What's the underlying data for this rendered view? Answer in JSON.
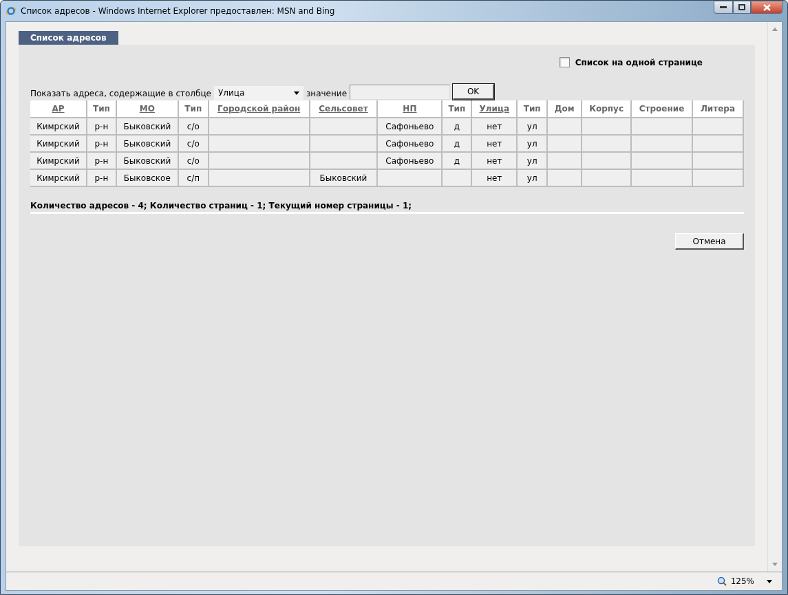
{
  "window": {
    "title": "Список адресов - Windows Internet Explorer предоставлен: MSN and Bing"
  },
  "tab": {
    "label": "Список адресов"
  },
  "single_page": {
    "label": "Список на одной странице",
    "checked": false
  },
  "filter": {
    "label": "Показать адреса, содержащие в столбце",
    "column": "Улица",
    "value_label": "значение",
    "ok": "OK"
  },
  "table": {
    "columns": [
      {
        "label": "АР",
        "sortable": true
      },
      {
        "label": "Тип",
        "sortable": false
      },
      {
        "label": "МО",
        "sortable": true
      },
      {
        "label": "Тип",
        "sortable": false
      },
      {
        "label": "Городской район",
        "sortable": true
      },
      {
        "label": "Сельсовет",
        "sortable": true
      },
      {
        "label": "НП",
        "sortable": true
      },
      {
        "label": "Тип",
        "sortable": false
      },
      {
        "label": "Улица",
        "sortable": true
      },
      {
        "label": "Тип",
        "sortable": false
      },
      {
        "label": "Дом",
        "sortable": false
      },
      {
        "label": "Корпус",
        "sortable": false
      },
      {
        "label": "Строение",
        "sortable": false
      },
      {
        "label": "Литера",
        "sortable": false
      }
    ],
    "rows": [
      [
        "Кимрский",
        "р-н",
        "Быковский",
        "с/о",
        "",
        "",
        "Сафоньево",
        "д",
        "нет",
        "ул",
        "",
        "",
        "",
        ""
      ],
      [
        "Кимрский",
        "р-н",
        "Быковский",
        "с/о",
        "",
        "",
        "Сафоньево",
        "д",
        "нет",
        "ул",
        "",
        "",
        "",
        ""
      ],
      [
        "Кимрский",
        "р-н",
        "Быковский",
        "с/о",
        "",
        "",
        "Сафоньево",
        "д",
        "нет",
        "ул",
        "",
        "",
        "",
        ""
      ],
      [
        "Кимрский",
        "р-н",
        "Быковское",
        "с/п",
        "",
        "Быковский",
        "",
        "",
        "нет",
        "ул",
        "",
        "",
        "",
        ""
      ]
    ]
  },
  "summary": "Количество адресов - 4; Количество страниц - 1; Текущий номер страницы - 1;",
  "cancel": "Отмена",
  "status_bar": {
    "zoom": "125%"
  }
}
